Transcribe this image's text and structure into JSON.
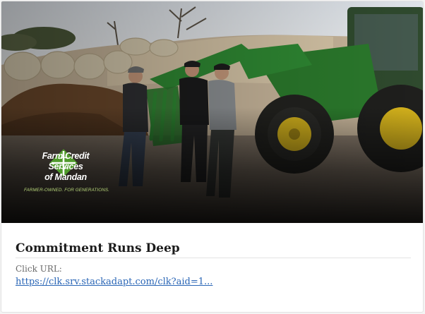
{
  "ad": {
    "image_alt": "Three men talking beside a green tractor in front of hay bales",
    "logo": {
      "icon": "green-diamond-leaf-icon",
      "name_line1": "Farm Credit Services",
      "name_line2": "of Mandan",
      "tagline": "FARMER-OWNED. FOR GENERATIONS."
    },
    "headline": "Commitment Runs Deep",
    "url_label": "Click URL:",
    "url_text": "https://clk.srv.stackadapt.com/clk?aid=1...",
    "colors": {
      "brand_green": "#4f9a2b",
      "tagline_green": "#b7d67a",
      "link_blue": "#2a66b6"
    }
  }
}
